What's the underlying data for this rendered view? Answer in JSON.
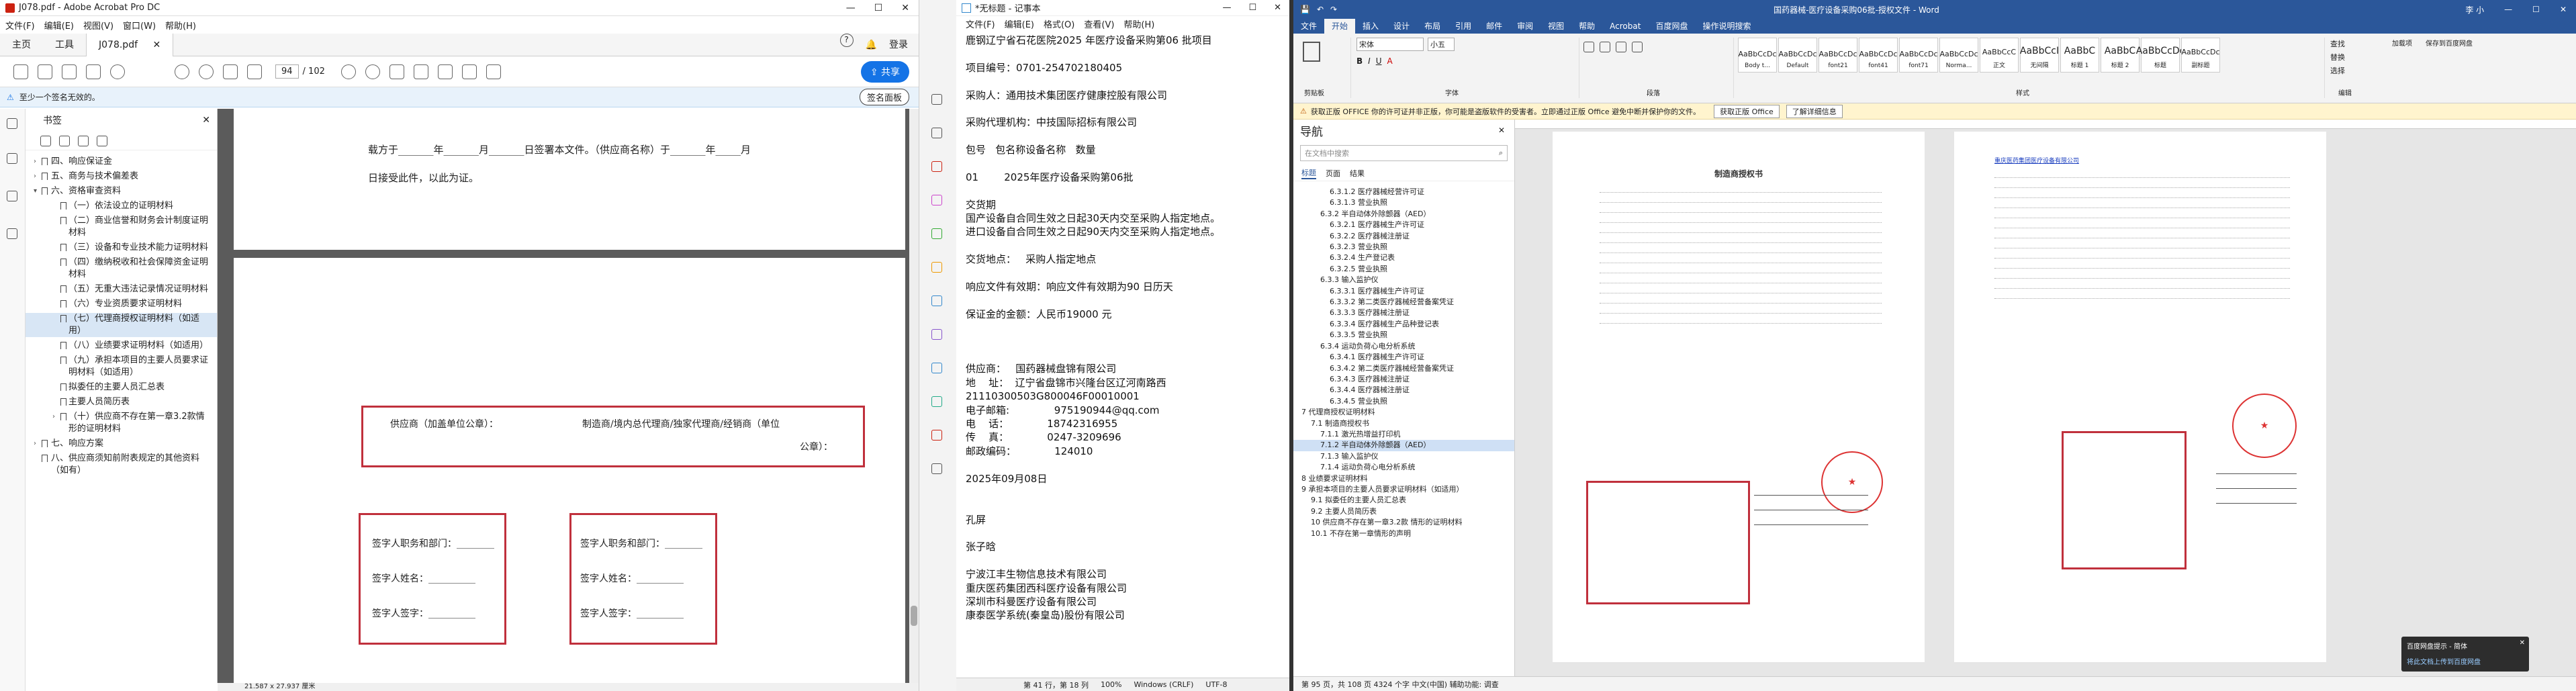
{
  "acrobat": {
    "title": "J078.pdf - Adobe Acrobat Pro DC",
    "menu": [
      "文件(F)",
      "编辑(E)",
      "视图(V)",
      "窗口(W)",
      "帮助(H)"
    ],
    "tabs": [
      "主页",
      "工具",
      "J078.pdf"
    ],
    "page_current": "94",
    "page_total": "/ 102",
    "share": "共享",
    "info": "至少一个签名无效的。",
    "sign_panel": "签名面板",
    "sidebar_title": "书签",
    "bookmarks": [
      {
        "t": "四、响应保证金",
        "e": ">",
        "l": 0
      },
      {
        "t": "五、商务与技术偏差表",
        "e": ">",
        "l": 0
      },
      {
        "t": "六、资格审查资料",
        "e": "v",
        "l": 0
      },
      {
        "t": "（一）依法设立的证明材料",
        "e": "",
        "l": 1
      },
      {
        "t": "（二）商业信誉和财务会计制度证明材料",
        "e": "",
        "l": 1
      },
      {
        "t": "（三）设备和专业技术能力证明材料",
        "e": "",
        "l": 1
      },
      {
        "t": "（四）缴纳税收和社会保障资金证明材料",
        "e": "",
        "l": 1
      },
      {
        "t": "（五）无重大违法记录情况证明材料",
        "e": "",
        "l": 1
      },
      {
        "t": "（六）专业资质要求证明材料",
        "e": "",
        "l": 1
      },
      {
        "t": "（七）代理商授权证明材料（如适用）",
        "e": "",
        "l": 1,
        "sel": true
      },
      {
        "t": "（八）业绩要求证明材料（如适用）",
        "e": "",
        "l": 1
      },
      {
        "t": "（九）承担本项目的主要人员要求证明材料（如适用）",
        "e": "",
        "l": 1
      },
      {
        "t": "拟委任的主要人员汇总表",
        "e": "",
        "l": 1
      },
      {
        "t": "主要人员简历表",
        "e": "",
        "l": 1
      },
      {
        "t": "（十）供应商不存在第一章3.2款情形的证明材料",
        "e": ">",
        "l": 1
      },
      {
        "t": "七、响应方案",
        "e": ">",
        "l": 0
      },
      {
        "t": "八、供应商须知前附表规定的其他资料（如有）",
        "e": "",
        "l": 0
      }
    ],
    "page_text": {
      "line1": "载方于_______年_______月_______日签署本文件。（供应商名称）于_______年_____月",
      "line2": "日接受此件，以此为证。",
      "sup_left": "供应商（加盖单位公章）：",
      "sup_right": "制造商/境内总代理商/独家代理商/经销商（单位",
      "sup_right2": "公章）：",
      "sig1": "签字人职务和部门：________",
      "sig2": "签字人姓名：__________",
      "sig3": "签字人签字：__________"
    },
    "status": "21.587 x 27.937 厘米"
  },
  "notepad": {
    "title": "*无标题 - 记事本",
    "menu": [
      "文件(F)",
      "编辑(E)",
      "格式(O)",
      "查看(V)",
      "帮助(H)"
    ],
    "lines": [
      "鹿钢辽宁省石花医院2025 年医疗设备采购第06 批项目",
      "",
      "项目编号：0701-254702180405",
      "",
      "采购人：通用技术集团医疗健康控股有限公司",
      "",
      "采购代理机构：中技国际招标有限公司",
      "",
      "包号   包名称设备名称   数量",
      "",
      "01        2025年医疗设备采购第06批",
      "",
      "交货期",
      "国产设备自合同生效之日起30天内交至采购人指定地点。",
      "进口设备自合同生效之日起90天内交至采购人指定地点。",
      "",
      "交货地点：   采购人指定地点",
      "",
      "响应文件有效期：响应文件有效期为90 日历天",
      "",
      "保证金的金额：人民币19000 元",
      "",
      "",
      "",
      "供应商：   国药器械盘锦有限公司",
      "地    址：  辽宁省盘锦市兴隆台区辽河南路西",
      "21110300503G800046F00010001",
      "电子邮箱:              975190944@qq.com",
      "电    话：            18742316955",
      "传    真：            0247-3209696",
      "邮政编码：            124010",
      "",
      "2025年09月08日",
      "",
      "",
      "孔屏",
      "",
      "张子晗",
      "",
      "宁波江丰生物信息技术有限公司",
      "重庆医药集团西科医疗设备有限公司",
      "深圳市科曼医疗设备有限公司",
      "康泰医学系统(秦皇岛)股份有限公司"
    ],
    "status": [
      "第 41 行，第 18 列",
      "100%",
      "Windows (CRLF)",
      "UTF-8"
    ]
  },
  "word": {
    "title": "国药器械-医疗设备采购06批-授权文件 - Word",
    "user": "李 小",
    "tabs": [
      "文件",
      "开始",
      "插入",
      "设计",
      "布局",
      "引用",
      "邮件",
      "审阅",
      "视图",
      "帮助",
      "Acrobat",
      "百度网盘",
      "操作说明搜索"
    ],
    "font_name": "宋体",
    "font_size": "小五",
    "styles": [
      "AaBbCcDc",
      "AaBbCcDc",
      "AaBbCcDc",
      "AaBbCcDc",
      "AaBbCcDc",
      "AaBbCcDc",
      "AaBbCcC",
      "AaBbCcI",
      "AaBbC",
      "AaBbC",
      "AaBbCcDc",
      "AaBbCcDc"
    ],
    "style_names": [
      "Body t...",
      "Default",
      "font21",
      "font41",
      "font71",
      "Norma...",
      "正文",
      "无间隔",
      "标题 1",
      "标题 2",
      "标题",
      "副标题"
    ],
    "group_labels": [
      "剪贴板",
      "字体",
      "段落",
      "样式",
      "编辑"
    ],
    "right_tools": [
      "查找",
      "替换",
      "选择",
      "加载项",
      "百度网盘",
      "保存到百度网盘"
    ],
    "notice": "获取正版 OFFICE  你的许可证并非正版，你可能是盗版软件的受害者。立即通过正版 Office 避免中断并保护你的文件。",
    "notice_btn1": "获取正版 Office",
    "notice_btn2": "了解详细信息",
    "nav_title": "导航",
    "nav_search": "在文档中搜索",
    "nav_tabs": [
      "标题",
      "页面",
      "结果"
    ],
    "nav_items": [
      "6.3.1.2 医疗器械经营许可证",
      "6.3.1.3 营业执照",
      "6.3.2 半自动体外除颤器（AED）",
      "6.3.2.1 医疗器械生产许可证",
      "6.3.2.2 医疗器械注册证",
      "6.3.2.3 营业执照",
      "6.3.2.4 生产登记表",
      "6.3.2.5 营业执照",
      "6.3.3 输入监护仪",
      "6.3.3.1 医疗器械生产许可证",
      "6.3.3.2 第二类医疗器械经营备案凭证",
      "6.3.3.3 医疗器械注册证",
      "6.3.3.4 医疗器械生产品种登记表",
      "6.3.3.5 营业执照",
      "6.3.4 运动负荷心电分析系统",
      "6.3.4.1 医疗器械生产许可证",
      "6.3.4.2 第二类医疗器械经营备案凭证",
      "6.3.4.3 医疗器械注册证",
      "6.3.4.4 医疗器械注册证",
      "6.3.4.5 营业执照",
      "7 代理商授权证明材料",
      "7.1 制造商授权书",
      "7.1.1 激光热增益打印机",
      "7.1.2 半自动体外除颤器（AED）",
      "7.1.3 输入监护仪",
      "7.1.4 运动负荷心电分析系统",
      "8 业绩要求证明材料",
      "9 承担本项目的主要人员要求证明材料（如适用）",
      "9.1 拟委任的主要人员汇总表",
      "9.2 主要人员简历表",
      "10 供应商不存在第一章3.2款 情形的证明材料",
      "10.1 不存在第一章情形的声明"
    ],
    "doc_title": "制造商授权书",
    "doc_company": "重庆医药集团医疗设备有限公司",
    "status": "第 95 页，共 108 页    4324 个字    中文(中国)    辅助功能: 调查",
    "toast_title": "百度网盘提示 - 简体",
    "toast_body": "将此文档上传到百度网盘"
  },
  "colors": {
    "sig_red": "#c0303c",
    "word_blue": "#2b579a",
    "notice_yellow": "#fff4ce",
    "acro_blue": "#1473e6"
  }
}
